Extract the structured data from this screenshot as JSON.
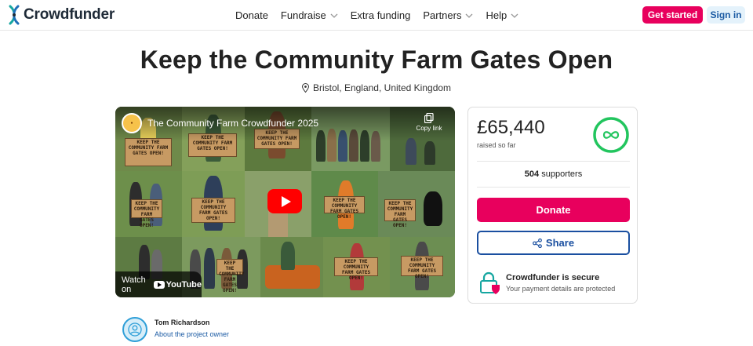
{
  "header": {
    "logo_text": "Crowdfunder",
    "nav": [
      {
        "label": "Donate",
        "has_dropdown": false
      },
      {
        "label": "Fundraise",
        "has_dropdown": true
      },
      {
        "label": "Extra funding",
        "has_dropdown": false
      },
      {
        "label": "Partners",
        "has_dropdown": true
      },
      {
        "label": "Help",
        "has_dropdown": true
      }
    ],
    "get_started_label": "Get started",
    "sign_in_label": "Sign in"
  },
  "project": {
    "title": "Keep the Community Farm Gates Open",
    "location": "Bristol, England, United Kingdom"
  },
  "video": {
    "title": "The Community Farm Crowdfunder 2025",
    "copy_link_label": "Copy link",
    "watch_on_label": "Watch on",
    "youtube_label": "YouTube",
    "sign_text": "KEEP THE COMMUNITY FARM GATES OPEN!"
  },
  "funding": {
    "amount": "£65,440",
    "raised_label": "raised so far",
    "progress_icon": "infinity-icon",
    "supporters_count": "504",
    "supporters_label": "supporters",
    "donate_label": "Donate",
    "share_label": "Share"
  },
  "security": {
    "title": "Crowdfunder is secure",
    "subtitle": "Your payment details are protected"
  },
  "owner": {
    "name": "Tom Richardson",
    "link_label": "About the project owner"
  },
  "colors": {
    "brand_pink": "#e8005d",
    "brand_blue": "#1a4fa0",
    "progress_green": "#22c55e",
    "logo_teal": "#15a6a0"
  }
}
